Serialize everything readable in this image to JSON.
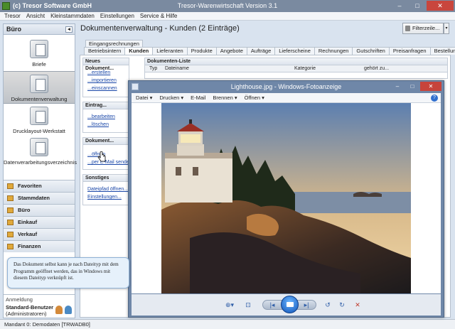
{
  "window": {
    "brand": "(c) Tresor Software GmbH",
    "title": "Tresor-Warenwirtschaft Version 3.1"
  },
  "menu": [
    "Tresor",
    "Ansicht",
    "Kleinstammdaten",
    "Einstellungen",
    "Service & Hilfe"
  ],
  "sidebar": {
    "title": "Büro",
    "collapse_glyph": "◂",
    "modules": [
      {
        "label": "Briefe",
        "icon": "letter-icon"
      },
      {
        "label": "Dokumentenverwaltung",
        "icon": "documents-icon"
      },
      {
        "label": "Drucklayout-Werkstatt",
        "icon": "print-layout-icon"
      },
      {
        "label": "Datenverarbeitungsverzeichnis",
        "icon": "data-register-icon"
      }
    ],
    "groups": [
      "Favoriten",
      "Stammdaten",
      "Büro",
      "Einkauf",
      "Verkauf",
      "Finanzen"
    ],
    "login": {
      "label": "Anmeldung",
      "user": "Standard-Benutzer",
      "role": "(Administratoren)"
    }
  },
  "status": "Mandant 0: Demodaten [TRWADB0]",
  "main": {
    "title": "Dokumentenverwaltung - Kunden (2 Einträge)",
    "filter_label": "Filterzeile...",
    "tabs_top": [
      "Eingangsrechnungen"
    ],
    "tabs": [
      "Betriebsintern",
      "Kunden",
      "Lieferanten",
      "Produkte",
      "Angebote",
      "Aufträge",
      "Lieferscheine",
      "Rechnungen",
      "Gutschriften",
      "Preisanfragen",
      "Bestellungen"
    ],
    "selected_tab": "Kunden",
    "actions": {
      "new_doc": {
        "title": "Neues Dokument...",
        "links": [
          "...erstellen",
          "...importieren",
          "...einscannen"
        ]
      },
      "entry": {
        "title": "Eintrag...",
        "links": [
          "...bearbeiten",
          "...löschen"
        ]
      },
      "document": {
        "title": "Dokument...",
        "links": [
          "...öffnen",
          "...per E-Mail senden"
        ]
      },
      "other": {
        "title": "Sonstiges",
        "links": [
          "Dateipfad öffnen...",
          "Einstellungen..."
        ]
      }
    },
    "doclist": {
      "title": "Dokumenten-Liste",
      "columns": [
        "Typ",
        "Dateiname",
        "Kategorie",
        "gehört zu..."
      ]
    }
  },
  "viewer": {
    "title": "Lighthouse.jpg - Windows-Fotoanzeige",
    "menu": [
      "Datei ▾",
      "Drucken ▾",
      "E-Mail",
      "Brennen ▾",
      "Öffnen ▾"
    ],
    "help_glyph": "?",
    "controls": {
      "zoom": "⊕▾",
      "fit": "⊡",
      "prev": "|◂",
      "next": "▸|",
      "rotate_left": "↺",
      "rotate_right": "↻",
      "delete": "✕"
    }
  },
  "window_buttons": {
    "minimize": "–",
    "maximize": "□",
    "close": "✕"
  },
  "tooltip": "Das Dokument selbst kann je nach Dateityp mit dem Programm geöffnet werden, das in Windows mit diesem Dateityp verknüpft ist.",
  "colors": {
    "accent": "#1a47a8",
    "titlebar": "#7a8aa0",
    "viewer_frame": "#6f87a8"
  }
}
